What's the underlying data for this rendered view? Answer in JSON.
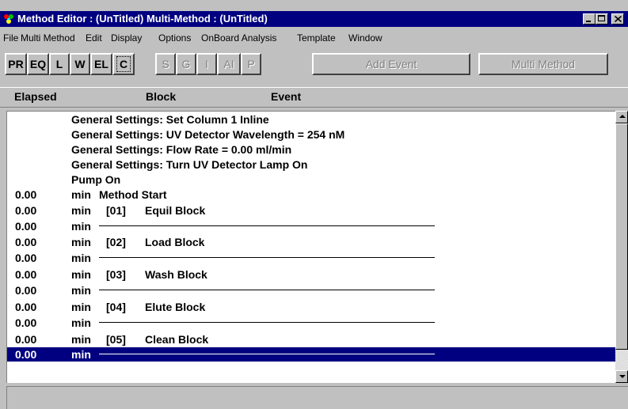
{
  "window": {
    "title": "Method Editor : (UnTitled)   Multi-Method : (UnTitled)",
    "controls": {
      "minimize": "_",
      "maximize": "□",
      "close": "✕"
    }
  },
  "colors": {
    "titlebar": "#000080",
    "selected_row": "#000080",
    "face": "#c0c0c0"
  },
  "menu": [
    {
      "label": "File"
    },
    {
      "label": "Multi Method"
    },
    {
      "label": "Edit"
    },
    {
      "label": "Display"
    },
    {
      "label": "Options"
    },
    {
      "label": "OnBoard Analysis"
    },
    {
      "label": "Template"
    },
    {
      "label": "Window"
    }
  ],
  "toolbar": {
    "buttons": [
      {
        "label": "PR",
        "enabled": true
      },
      {
        "label": "EQ",
        "enabled": true
      },
      {
        "label": "L",
        "enabled": true
      },
      {
        "label": "W",
        "enabled": true
      },
      {
        "label": "EL",
        "enabled": true
      },
      {
        "label": "C",
        "enabled": true,
        "pressed": true
      },
      {
        "label": "S",
        "enabled": false
      },
      {
        "label": "G",
        "enabled": false
      },
      {
        "label": "I",
        "enabled": false
      },
      {
        "label": "AI",
        "enabled": false
      },
      {
        "label": "P",
        "enabled": false
      }
    ],
    "add_event": "Add Event",
    "multi_method": "Multi Method"
  },
  "columns": {
    "elapsed": "Elapsed",
    "block": "Block",
    "event": "Event"
  },
  "list": {
    "settings": [
      "General Settings: Set Column 1 Inline",
      "General Settings: UV Detector Wavelength = 254 nM",
      "General Settings: Flow Rate = 0.00 ml/min",
      "General Settings: Turn UV Detector Lamp On",
      "Pump On"
    ],
    "rows": [
      {
        "time": "0.00",
        "unit": "min",
        "num": "",
        "text": "Method Start",
        "type": "text"
      },
      {
        "time": "0.00",
        "unit": "min",
        "num": "[01]",
        "text": "Equil Block",
        "type": "block"
      },
      {
        "time": "0.00",
        "unit": "min",
        "type": "rule"
      },
      {
        "time": "0.00",
        "unit": "min",
        "num": "[02]",
        "text": "Load Block",
        "type": "block"
      },
      {
        "time": "0.00",
        "unit": "min",
        "type": "rule"
      },
      {
        "time": "0.00",
        "unit": "min",
        "num": "[03]",
        "text": "Wash Block",
        "type": "block"
      },
      {
        "time": "0.00",
        "unit": "min",
        "type": "rule"
      },
      {
        "time": "0.00",
        "unit": "min",
        "num": "[04]",
        "text": "Elute Block",
        "type": "block"
      },
      {
        "time": "0.00",
        "unit": "min",
        "type": "rule"
      },
      {
        "time": "0.00",
        "unit": "min",
        "num": "[05]",
        "text": "Clean Block",
        "type": "block"
      },
      {
        "time": "0.00",
        "unit": "min",
        "type": "rule",
        "selected": true
      }
    ]
  },
  "icons": {
    "app": "colorful-app-icon",
    "scroll_up": "scroll-up-arrow-icon",
    "scroll_down": "scroll-down-arrow-icon"
  }
}
